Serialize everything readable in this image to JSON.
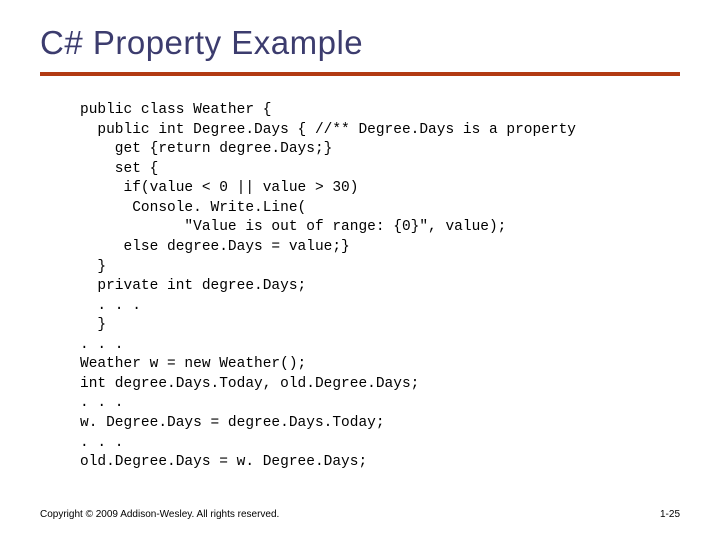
{
  "slide": {
    "title": "C# Property Example",
    "code": "public class Weather {\n  public int Degree.Days { //** Degree.Days is a property\n    get {return degree.Days;}\n    set {\n     if(value < 0 || value > 30)\n      Console. Write.Line(\n            \"Value is out of range: {0}\", value);\n     else degree.Days = value;}\n  }\n  private int degree.Days;\n  . . .\n  }\n. . .\nWeather w = new Weather();\nint degree.Days.Today, old.Degree.Days;\n. . .\nw. Degree.Days = degree.Days.Today;\n. . .\nold.Degree.Days = w. Degree.Days;",
    "copyright": "Copyright © 2009 Addison-Wesley. All rights reserved.",
    "page_number": "1-25"
  }
}
